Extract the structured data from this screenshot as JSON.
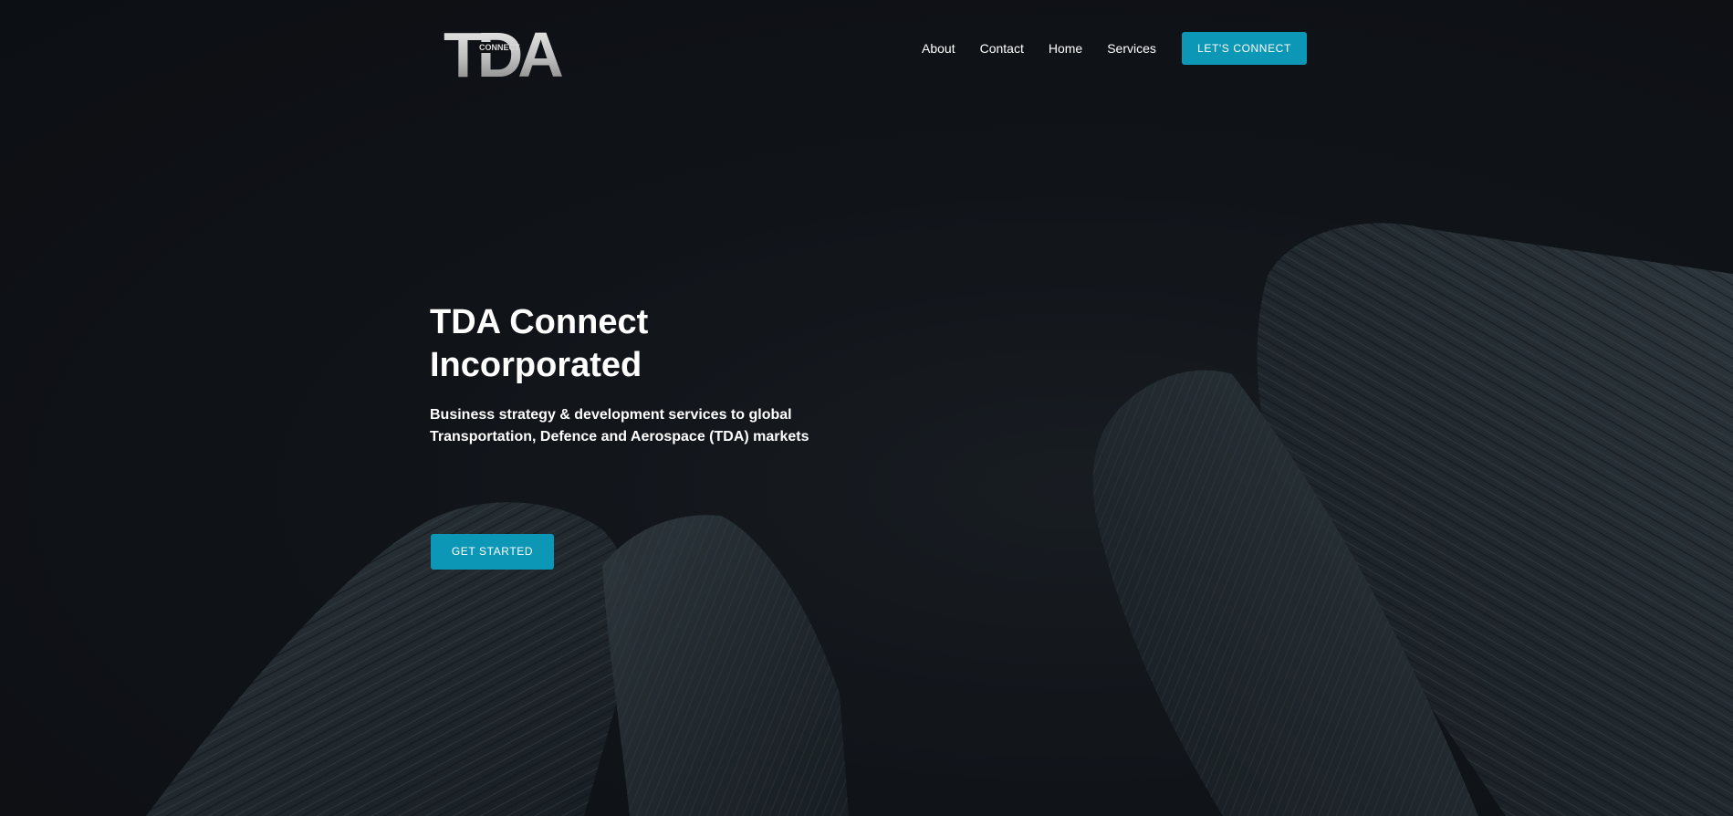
{
  "logo": {
    "main_text": "TDA",
    "sub_text": "CONNECT"
  },
  "nav": {
    "items": [
      {
        "label": "About"
      },
      {
        "label": "Contact"
      },
      {
        "label": "Home"
      },
      {
        "label": "Services"
      }
    ],
    "cta_label": "LET'S CONNECT"
  },
  "hero": {
    "title": "TDA Connect Incorporated",
    "subtitle": "Business strategy & development services to global Transportation, Defence and Aerospace (TDA) markets",
    "cta_label": "GET STARTED"
  },
  "colors": {
    "accent": "#0d97b6",
    "background": "#0e1014",
    "text": "#ffffff"
  }
}
